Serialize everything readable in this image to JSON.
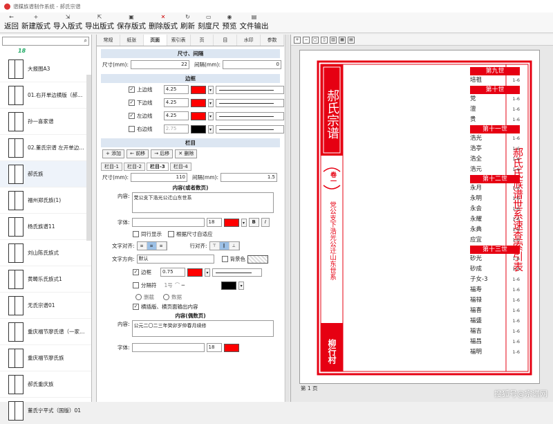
{
  "window": {
    "title": "谱牒族谱制作系统 - 郝氏宗谱"
  },
  "toolbar": [
    {
      "label": "返回",
      "icon": "arrow"
    },
    {
      "label": "新建版式",
      "icon": "plus"
    },
    {
      "label": "导入版式",
      "icon": "import"
    },
    {
      "label": "导出版式",
      "icon": "export"
    },
    {
      "label": "保存版式",
      "icon": "save"
    },
    {
      "label": "删除版式",
      "icon": "delete"
    },
    {
      "label": "刷新",
      "icon": "refresh"
    },
    {
      "label": "刻度尺",
      "icon": "ruler"
    },
    {
      "label": "预览",
      "icon": "eye"
    },
    {
      "label": "文件输出",
      "icon": "file"
    }
  ],
  "left": {
    "search": {
      "value": "",
      "placeholder": ""
    },
    "header": "18",
    "items": [
      "大报图A3",
      "01.右开单边横版（郝…",
      "孙一喜家谱",
      "02.董氏宗谱 左开单边…",
      "郝氏族",
      "福州郑氏族(1)",
      "杨氏族谱11",
      "刘山陈氏族式",
      "黄畴乐氏族式1",
      "无氏宗谱01",
      "重庆福节廖氏谱（一家…",
      "重庆福节廖氏族",
      "郝氏重庆族",
      "董氏宁平式（国版）01"
    ],
    "selected_index": 4
  },
  "mid": {
    "tabs": [
      "常规",
      "纸张",
      "页面",
      "索引表",
      "页",
      "目",
      "水印",
      "参数"
    ],
    "active_tab": 2,
    "size_section": {
      "title": "尺寸、间隔",
      "size_label": "尺寸(mm):",
      "size_value": "22",
      "gap_label": "间隔(mm):",
      "gap_value": "0"
    },
    "border_section": {
      "title": "边框",
      "rows": [
        {
          "label": "上边线",
          "checked": true,
          "width": "4.25",
          "color": "#ff0000"
        },
        {
          "label": "下边线",
          "checked": true,
          "width": "4.25",
          "color": "#ff0000"
        },
        {
          "label": "左边线",
          "checked": true,
          "width": "4.25",
          "color": "#ff0000"
        },
        {
          "label": "右边线",
          "checked": false,
          "width": "2.75",
          "color": "#000000"
        }
      ]
    },
    "column_section": {
      "title": "栏目",
      "buttons": [
        "添加",
        "前移",
        "后移",
        "删除"
      ],
      "subtabs": [
        "栏目-1",
        "栏目-2",
        "栏目-3",
        "栏目-4"
      ],
      "active_subtab": 2,
      "size_label": "尺寸(mm):",
      "size_value": "110",
      "gap_label": "间隔(mm):",
      "gap_value": "1.5",
      "content_title": "内容(或者数页)",
      "content_label": "内容:",
      "content_value": "党公支下浩光公迁山东世系",
      "font_label": "字体:",
      "font_size": "18",
      "font_color": "#ff0000",
      "bold": "B",
      "italic": "I",
      "check_multi": "同行显示",
      "check_auto": "根据尺寸自适应",
      "align_label": "文字对齐:",
      "valign_label": "行对齐:",
      "dir_label": "文字方向:",
      "dir_value": "默认",
      "bg_label": "背景色",
      "border_label": "边框",
      "border_width": "0.75",
      "border_color": "#ff0000",
      "sep_label": "分隔符",
      "sep_value": "1号",
      "sep_color": "#000000",
      "opt_a": "删截",
      "opt_b": "数据",
      "opt_c": "横插版、横页面输出内容",
      "content2_title": "内容(偶数页)",
      "content2_label": "内容:",
      "content2_value": "公元二〇二三年癸卯岁仲春月续修",
      "font2_label": "字体:",
      "font2_size": "18",
      "font2_color": "#ff0000"
    }
  },
  "preview": {
    "banner_title": "郝氏宗谱",
    "volume": "卷一",
    "side_text": "党公支下浩光公迁山东世系",
    "village": "柳行村",
    "right_title": "郝氏氏族谱世系速查索引表",
    "page_indicator": "第 1 页",
    "generations": [
      {
        "header": "第九世",
        "rows": [
          [
            "培祖",
            "1-6"
          ]
        ]
      },
      {
        "header": "第十世",
        "rows": [
          [
            "党",
            "1-6"
          ],
          [
            "澶",
            "1-6"
          ],
          [
            "贵",
            "1-6"
          ]
        ]
      },
      {
        "header": "第十一世",
        "rows": [
          [
            "浩光",
            "1-6"
          ],
          [
            "浩亭",
            "1-6"
          ],
          [
            "浩全",
            "1-6"
          ],
          [
            "浩元",
            "1-6"
          ]
        ]
      },
      {
        "header": "第十二世",
        "rows": [
          [
            "永月",
            "1-6"
          ],
          [
            "永明",
            "1-6"
          ],
          [
            "永会",
            "1-6"
          ],
          [
            "永耀",
            "1-6"
          ],
          [
            "永典",
            "1-6"
          ],
          [
            "应宜",
            "1-6"
          ]
        ]
      },
      {
        "header": "第十三世",
        "rows": [
          [
            "砂光",
            "1-6"
          ],
          [
            "砂成",
            "1-6"
          ],
          [
            "子女-3",
            "1-6"
          ],
          [
            "福寿",
            "1-6"
          ],
          [
            "福禄",
            "1-6"
          ],
          [
            "福喜",
            "1-6"
          ],
          [
            "福盛",
            "1-6"
          ],
          [
            "福吉",
            "1-6"
          ],
          [
            "福昌",
            "1-6"
          ],
          [
            "福明",
            "1-6"
          ]
        ]
      }
    ],
    "watermark": "搜狐号@宗谱网"
  },
  "colors": {
    "accent_red": "#e60012",
    "select_blue": "#9cc0e6",
    "section_bg": "#dce6f2"
  }
}
